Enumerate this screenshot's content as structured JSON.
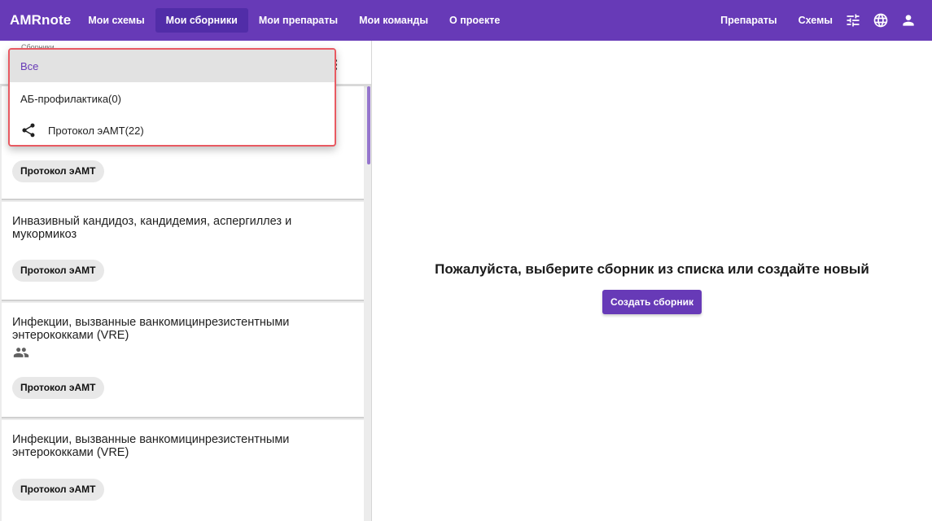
{
  "header": {
    "logo": "AMRnote",
    "nav": [
      {
        "label": "Мои схемы"
      },
      {
        "label": "Мои сборники",
        "active": true
      },
      {
        "label": "Мои препараты"
      },
      {
        "label": "Мои команды"
      },
      {
        "label": "О проекте"
      }
    ],
    "right_links": [
      {
        "label": "Препараты"
      },
      {
        "label": "Схемы"
      }
    ],
    "icons": [
      "tune-icon",
      "globe-icon",
      "account-icon"
    ]
  },
  "filter": {
    "caption": "Сборники"
  },
  "dropdown": {
    "items": [
      {
        "label": "Все",
        "selected": true
      },
      {
        "label": "АБ-профилактика(0)"
      },
      {
        "label": "Протокол эАМТ(22)",
        "icon": "share-icon"
      }
    ]
  },
  "list": {
    "cards": [
      {
        "title": "",
        "chip": "Протокол эАМТ"
      },
      {
        "title": "Инвазивный кандидоз, кандидемия, аспергиллез и мукормикоз",
        "chip": "Протокол эАМТ"
      },
      {
        "title": "Инфекции, вызванные ванкомицинрезистентными энтерококками (VRE)",
        "chip": "Протокол эАМТ",
        "icon": "group-icon"
      },
      {
        "title": "Инфекции, вызванные ванкомицинрезистентными энтерококками (VRE)",
        "chip": "Протокол эАМТ"
      }
    ]
  },
  "main": {
    "empty_message": "Пожалуйста, выберите сборник из списка или создайте новый",
    "create_button": "Создать сборник"
  },
  "colors": {
    "primary": "#673ab7",
    "primary_dark": "#512da8",
    "highlight_border": "#e85a62"
  }
}
